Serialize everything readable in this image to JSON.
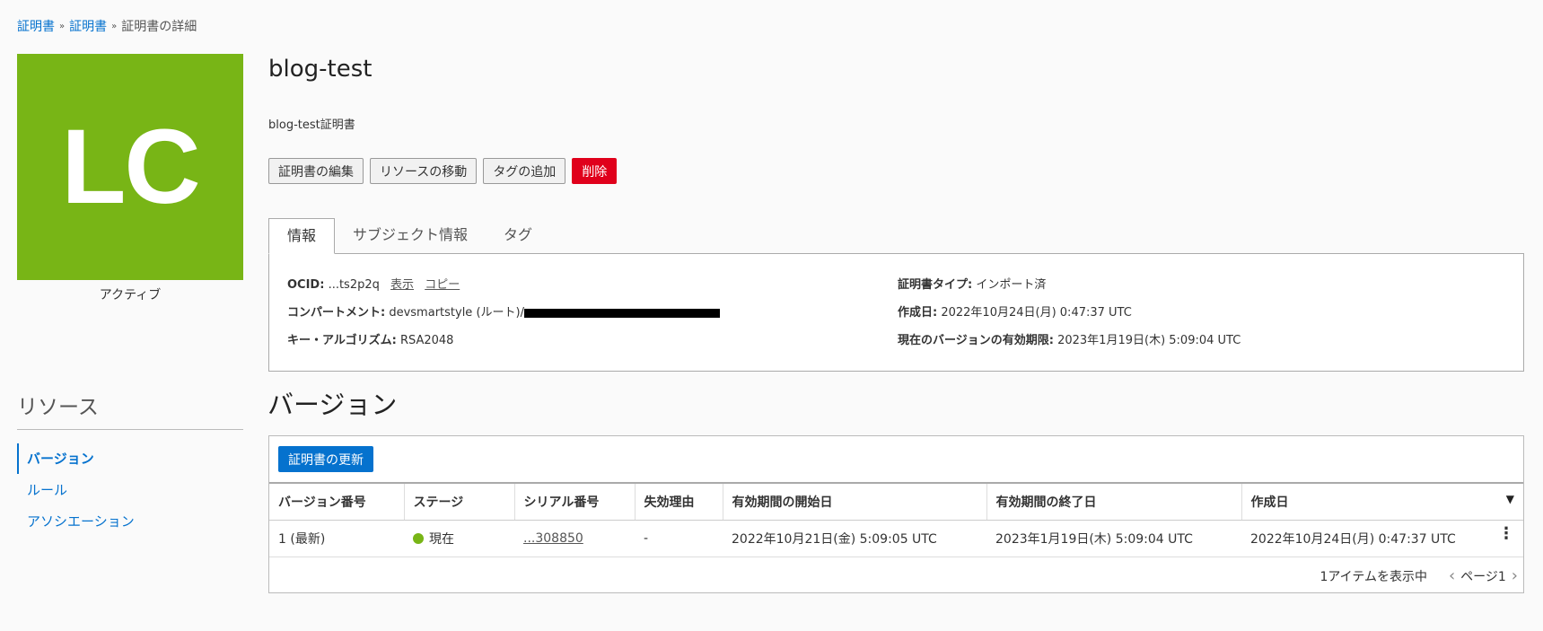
{
  "breadcrumb": {
    "items": [
      "証明書",
      "証明書"
    ],
    "current": "証明書の詳細"
  },
  "avatar": {
    "initials": "LC",
    "color": "#78b516"
  },
  "status": "アクティブ",
  "header": {
    "title": "blog-test",
    "description": "blog-test証明書"
  },
  "actions": {
    "edit": "証明書の編集",
    "move": "リソースの移動",
    "add_tags": "タグの追加",
    "delete": "削除"
  },
  "tabs": [
    "情報",
    "サブジェクト情報",
    "タグ"
  ],
  "info": {
    "ocid_label": "OCID:",
    "ocid_value": "...ts2p2q",
    "show_link": "表示",
    "copy_link": "コピー",
    "compartment_label": "コンパートメント:",
    "compartment_value": "devsmartstyle (ルート)/",
    "algorithm_label": "キー・アルゴリズム:",
    "algorithm_value": "RSA2048",
    "cert_type_label": "証明書タイプ:",
    "cert_type_value": "インポート済",
    "created_label": "作成日:",
    "created_value": "2022年10月24日(月) 0:47:37 UTC",
    "expiry_label": "現在のバージョンの有効期限:",
    "expiry_value": "2023年1月19日(木) 5:09:04 UTC"
  },
  "resources": {
    "title": "リソース",
    "items": [
      "バージョン",
      "ルール",
      "アソシエーション"
    ]
  },
  "versions": {
    "title": "バージョン",
    "renew_button": "証明書の更新",
    "columns": [
      "バージョン番号",
      "ステージ",
      "シリアル番号",
      "失効理由",
      "有効期間の開始日",
      "有効期間の終了日",
      "作成日"
    ],
    "rows": [
      {
        "version": "1 (最新)",
        "stage": "現在",
        "serial": "...308850",
        "revocation": "-",
        "valid_from": "2022年10月21日(金) 5:09:05 UTC",
        "valid_to": "2023年1月19日(木) 5:09:04 UTC",
        "created": "2022年10月24日(月) 0:47:37 UTC"
      }
    ],
    "footer_count": "1アイテムを表示中",
    "page_label": "ページ1"
  },
  "colors": {
    "accent": "#0572ce",
    "danger": "#e0001b",
    "status_ok": "#78b516"
  }
}
